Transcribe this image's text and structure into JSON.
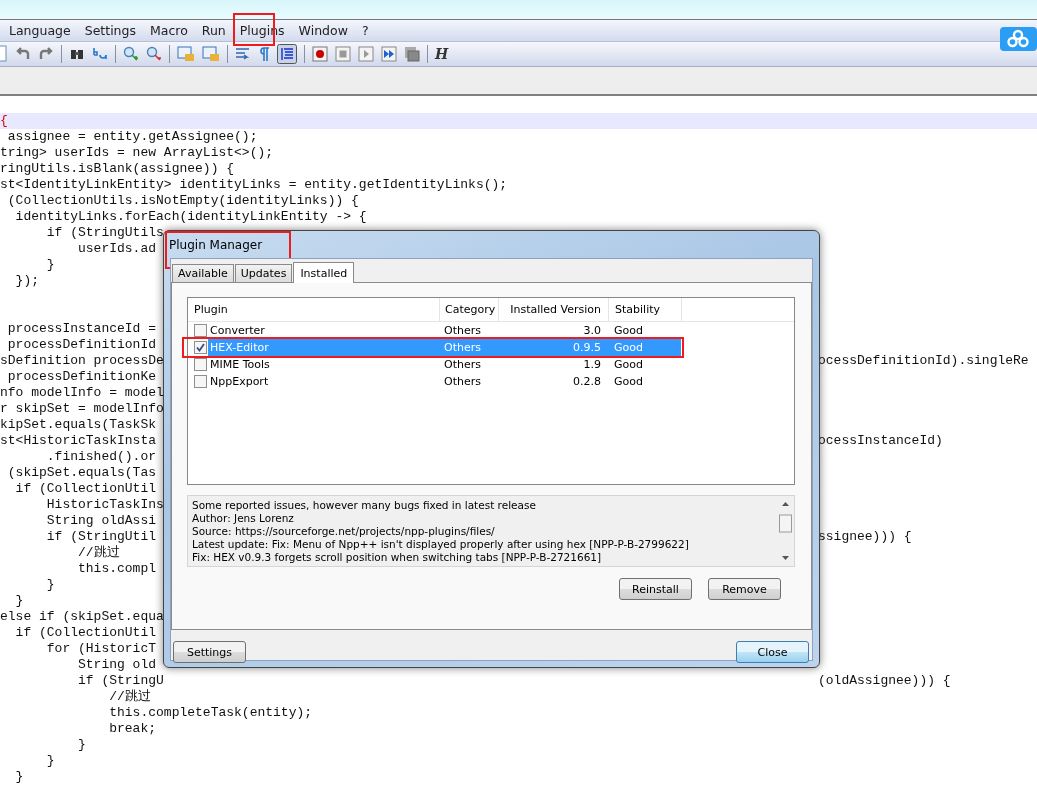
{
  "menu": [
    {
      "label": "Language",
      "annotated": false
    },
    {
      "label": "Settings",
      "annotated": false
    },
    {
      "label": "Macro",
      "annotated": false
    },
    {
      "label": "Run",
      "annotated": false
    },
    {
      "label": "Plugins",
      "annotated": true
    },
    {
      "label": "Window",
      "annotated": false
    },
    {
      "label": "?",
      "annotated": false
    }
  ],
  "toolbar_glyph": "H",
  "code_lines": [
    {
      "kind": "code",
      "text": "{",
      "current": true,
      "matched_brace": true
    },
    {
      "kind": "code",
      "text": " assignee = entity.getAssignee();",
      "current": false,
      "matched_brace": false
    },
    {
      "kind": "code",
      "text": "tring> userIds = new ArrayList<>();",
      "current": false,
      "matched_brace": false
    },
    {
      "kind": "code",
      "text": "ringUtils.isBlank(assignee)) {",
      "current": false,
      "matched_brace": false
    },
    {
      "kind": "code",
      "text": "st<IdentityLinkEntity> identityLinks = entity.getIdentityLinks();",
      "current": false,
      "matched_brace": false
    },
    {
      "kind": "code",
      "text": " (CollectionUtils.isNotEmpty(identityLinks)) {",
      "current": false,
      "matched_brace": false
    },
    {
      "kind": "code",
      "text": "  identityLinks.forEach(identityLinkEntity -> {",
      "current": false,
      "matched_brace": false
    },
    {
      "kind": "code",
      "text": "      if (StringUtils",
      "current": false,
      "matched_brace": false
    },
    {
      "kind": "code",
      "text": "          userIds.ad",
      "current": false,
      "matched_brace": false
    },
    {
      "kind": "code",
      "text": "      }",
      "current": false,
      "matched_brace": false
    },
    {
      "kind": "code",
      "text": "  });",
      "current": false,
      "matched_brace": false
    },
    {
      "kind": "blank"
    },
    {
      "kind": "blank"
    },
    {
      "kind": "code",
      "text": " processInstanceId =",
      "current": false,
      "matched_brace": false
    },
    {
      "kind": "code",
      "text": " processDefinitionId",
      "current": false,
      "matched_brace": false
    },
    {
      "kind": "code",
      "text": "sDefinition processDe",
      "end": "ocessDefinitionId).singleRe",
      "current": false,
      "matched_brace": false
    },
    {
      "kind": "code",
      "text": " processDefinitionKe",
      "current": false,
      "matched_brace": false
    },
    {
      "kind": "code",
      "text": "nfo modelInfo = model",
      "current": false,
      "matched_brace": false
    },
    {
      "kind": "code",
      "text": "r skipSet = modelInfo",
      "current": false,
      "matched_brace": false
    },
    {
      "kind": "code",
      "text": "kipSet.equals(TaskSk",
      "current": false,
      "matched_brace": false
    },
    {
      "kind": "code",
      "text": "st<HistoricTaskInsta",
      "end": "ocessInstanceId)",
      "current": false,
      "matched_brace": false
    },
    {
      "kind": "code",
      "text": "      .finished().or",
      "current": false,
      "matched_brace": false
    },
    {
      "kind": "code",
      "text": " (skipSet.equals(Tas",
      "current": false,
      "matched_brace": false
    },
    {
      "kind": "code",
      "text": "  if (CollectionUtil",
      "current": false,
      "matched_brace": false
    },
    {
      "kind": "code",
      "text": "      HistoricTaskIns",
      "current": false,
      "matched_brace": false
    },
    {
      "kind": "code",
      "text": "      String oldAssi",
      "current": false,
      "matched_brace": false
    },
    {
      "kind": "code",
      "text": "      if (StringUtil",
      "end": "ssignee))) {",
      "current": false,
      "matched_brace": false
    },
    {
      "kind": "code",
      "text": "          //跳过",
      "current": false,
      "matched_brace": false
    },
    {
      "kind": "code",
      "text": "          this.compl",
      "current": false,
      "matched_brace": false
    },
    {
      "kind": "code",
      "text": "      }",
      "current": false,
      "matched_brace": false
    },
    {
      "kind": "code",
      "text": "  }",
      "current": false,
      "matched_brace": false
    },
    {
      "kind": "code",
      "text": "else if (skipSet.equa",
      "current": false,
      "matched_brace": false
    },
    {
      "kind": "code",
      "text": "  if (CollectionUtil",
      "current": false,
      "matched_brace": false
    },
    {
      "kind": "code",
      "text": "      for (HistoricT",
      "current": false,
      "matched_brace": false
    },
    {
      "kind": "code",
      "text": "          String old",
      "current": false,
      "matched_brace": false
    },
    {
      "kind": "code",
      "text": "          if (StringU",
      "end": "(oldAssignee))) {",
      "current": false,
      "matched_brace": false
    },
    {
      "kind": "code",
      "text": "              //跳过",
      "current": false,
      "matched_brace": false
    },
    {
      "kind": "code",
      "text": "              this.completeTask(entity);",
      "current": false,
      "matched_brace": false
    },
    {
      "kind": "code",
      "text": "              break;",
      "current": false,
      "matched_brace": false
    },
    {
      "kind": "code",
      "text": "          }",
      "current": false,
      "matched_brace": false
    },
    {
      "kind": "code",
      "text": "      }",
      "current": false,
      "matched_brace": false
    },
    {
      "kind": "code",
      "text": "  }",
      "current": false,
      "matched_brace": false
    }
  ],
  "dialog": {
    "title": "Plugin Manager",
    "title_annotated": true,
    "tabs": [
      {
        "label": "Available",
        "selected": false
      },
      {
        "label": "Updates",
        "selected": false
      },
      {
        "label": "Installed",
        "selected": true
      }
    ],
    "columns": [
      "Plugin",
      "Category",
      "Installed Version",
      "Stability"
    ],
    "rows": [
      {
        "plugin": "Converter",
        "category": "Others",
        "version": "3.0",
        "stability": "Good",
        "checked": false,
        "selected": false,
        "annotated": false
      },
      {
        "plugin": "HEX-Editor",
        "category": "Others",
        "version": "0.9.5",
        "stability": "Good",
        "checked": true,
        "selected": true,
        "annotated": true
      },
      {
        "plugin": "MIME Tools",
        "category": "Others",
        "version": "1.9",
        "stability": "Good",
        "checked": false,
        "selected": false,
        "annotated": false
      },
      {
        "plugin": "NppExport",
        "category": "Others",
        "version": "0.2.8",
        "stability": "Good",
        "checked": false,
        "selected": false,
        "annotated": false
      }
    ],
    "description": [
      "Some reported issues, however many bugs fixed in latest release",
      "Author: Jens Lorenz",
      "Source: https://sourceforge.net/projects/npp-plugins/files/",
      "Latest update: Fix: Menu of Npp++ isn't displayed properly after using hex [NPP-P-B-2799622]",
      "Fix: HEX v0.9.3 forgets scroll position when switching tabs [NPP-P-B-2721661]"
    ],
    "action_buttons": [
      "Reinstall",
      "Remove"
    ],
    "footer_buttons": [
      {
        "label": "Settings",
        "default": false
      },
      {
        "label": "Close",
        "default": true
      }
    ]
  }
}
